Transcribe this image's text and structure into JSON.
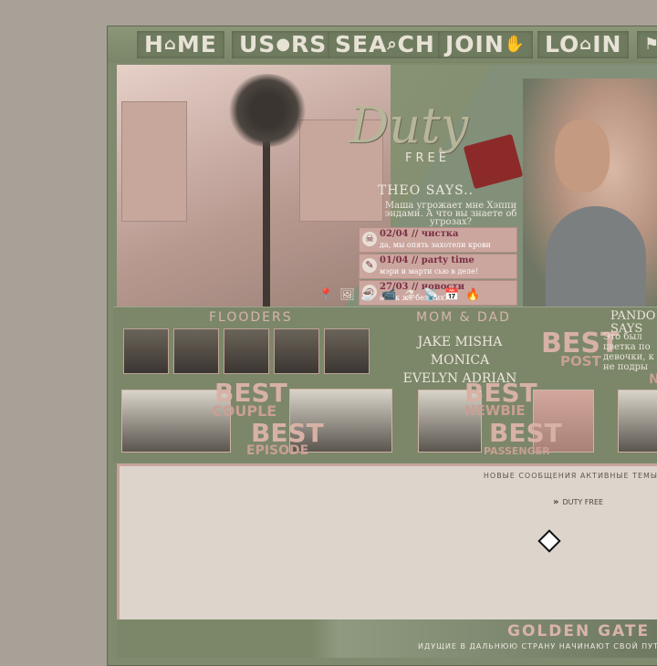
{
  "nav": {
    "items": [
      {
        "pre": "H",
        "icon": "⌂",
        "post": "ME"
      },
      {
        "pre": "US",
        "icon": "●",
        "post": "RS"
      },
      {
        "pre": "SEA",
        "icon": "⌕",
        "post": "CH"
      },
      {
        "pre": "JOIN",
        "icon": "✋",
        "post": ""
      },
      {
        "pre": "LO",
        "icon": "⌂",
        "post": "IN"
      },
      {
        "pre": "",
        "icon": "⚑",
        "post": ""
      }
    ]
  },
  "header": {
    "logo": "Duty",
    "logo_sub": "FREE",
    "says_title": "THEO SAYS..",
    "quote": "Маша угрожает мне Хэппи эндами. А что вы знаете об угрозах?",
    "news": [
      {
        "date": "02/04",
        "sep": " // ",
        "title": "чистка",
        "text": "да, мы опять захотели крови",
        "icon": "☠"
      },
      {
        "date": "01/04",
        "sep": " // ",
        "title": "party time",
        "text": "мэри и марти сью в деле!",
        "icon": "✎"
      },
      {
        "date": "27/03",
        "sep": " // ",
        "title": "новости",
        "text": "а как же без них?",
        "icon": "◎"
      }
    ],
    "tools": [
      "📍",
      "🖼",
      "☕",
      "📹",
      "⚗",
      "📡",
      "📅",
      "🔥"
    ]
  },
  "strip": {
    "floodersTitle": "FLOODERS",
    "momDadTitle": "MOM & DAD",
    "momDadNames": [
      "JAKE MISHA MONICA",
      "EVELYN ADRIAN"
    ],
    "pandoraTitle": "PANDO",
    "pandoraSays": "SAYS",
    "pandoraText": [
      "Это был",
      "цветка по",
      "девочки, к",
      "не подры"
    ],
    "best_post_word": "BEST",
    "best_post_label": "POST",
    "best_couple_word": "BEST",
    "best_couple_label": "COUPLE",
    "best_episode_word": "BEST",
    "best_episode_label": "EPISODE",
    "best_newbie_word": "BEST",
    "best_newbie_label": "NEWBIE",
    "best_passenger_word": "BEST",
    "best_passenger_label": "PASSENGER",
    "n_label": "N"
  },
  "content": {
    "tabs": "НОВЫЕ СООБЩЕНИЯ   АКТИВНЫЕ ТЕМЫ",
    "crumb_mark": "»",
    "crumb": "DUTY FREE"
  },
  "footer": {
    "title": "GOLDEN  GATE",
    "text": "ИДУЩИЕ В ДАЛЬНЮЮ СТРАНУ НАЧИНАЮТ СВОЙ ПУТЬ С"
  }
}
